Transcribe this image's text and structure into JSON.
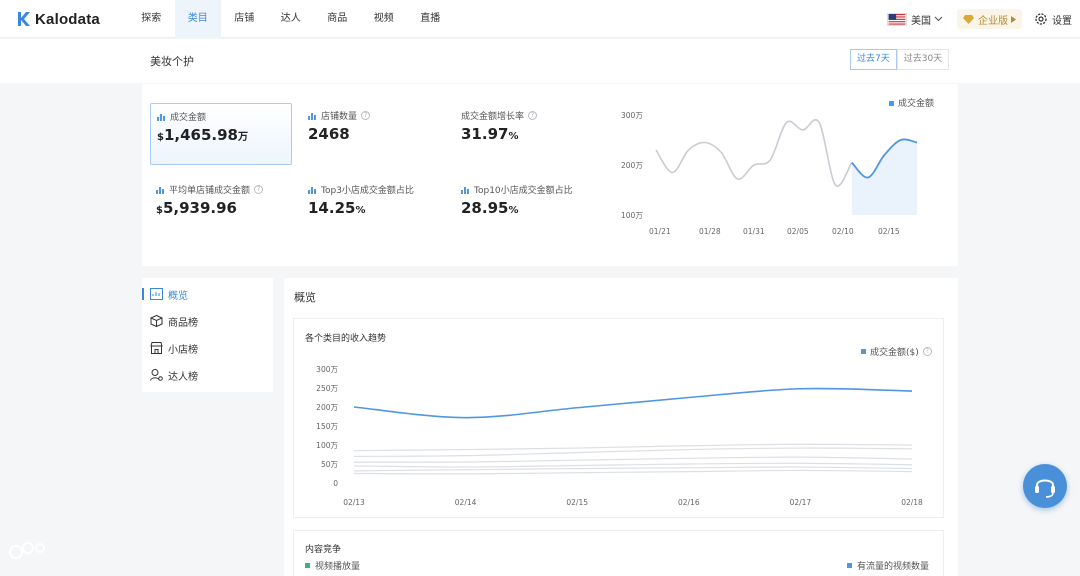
{
  "nav": {
    "brand": "Kalodata",
    "tabs": [
      "探索",
      "类目",
      "店铺",
      "达人",
      "商品",
      "视频",
      "直播"
    ],
    "active_tab": 1,
    "country": "美国",
    "enterprise": "企业版",
    "settings": "设置"
  },
  "header": {
    "title": "美妆个护",
    "range_options": [
      "过去7天",
      "过去30天"
    ],
    "range_active": 0
  },
  "metrics": [
    {
      "label": "成交金额",
      "prefix": "$",
      "value": "1,465.98",
      "suffix": "万",
      "help": false
    },
    {
      "label": "店铺数量",
      "prefix": "",
      "value": "2468",
      "suffix": "",
      "help": true
    },
    {
      "label": "成交金额增长率",
      "prefix": "",
      "value": "31.97",
      "suffix": "%",
      "help": true
    },
    {
      "label": "平均单店铺成交金额",
      "prefix": "$",
      "value": "5,939.96",
      "suffix": "",
      "help": true
    },
    {
      "label": "Top3小店成交金额占比",
      "prefix": "",
      "value": "14.25",
      "suffix": "%",
      "help": false
    },
    {
      "label": "Top10小店成交金额占比",
      "prefix": "",
      "value": "28.95",
      "suffix": "%",
      "help": false
    }
  ],
  "mini_chart": {
    "legend": "成交金额",
    "y_ticks": [
      "300万",
      "200万",
      "100万"
    ],
    "x_ticks": [
      "01/21",
      "01/28",
      "01/31",
      "02/05",
      "02/10",
      "02/15"
    ],
    "color": "#4f96e3"
  },
  "sidebar": {
    "items": [
      "概览",
      "商品榜",
      "小店榜",
      "达人榜"
    ],
    "active": 0
  },
  "overview": {
    "title": "概览",
    "chart_title": "各个类目的收入趋势",
    "legend": "成交金额($)",
    "y_ticks": [
      "300万",
      "250万",
      "200万",
      "150万",
      "100万",
      "50万",
      "0"
    ],
    "x_ticks": [
      "02/13",
      "02/14",
      "02/15",
      "02/16",
      "02/17",
      "02/18"
    ],
    "content_title": "内容竞争",
    "content_legend": [
      "视频播放量",
      "有流量的视频数量"
    ],
    "color": "#4f96e3",
    "content_colors": [
      "#3bb37a",
      "#4f96e3"
    ]
  },
  "chart_data": [
    {
      "type": "line",
      "legend": [
        "成交金额"
      ],
      "x_ticks": [
        "01/21",
        "01/28",
        "01/31",
        "02/05",
        "02/10",
        "02/15"
      ],
      "ylabel": "",
      "ylim": [
        100,
        300
      ],
      "y_unit": "万",
      "series": [
        {
          "name": "成交金额",
          "values": [
            230,
            185,
            230,
            245,
            225,
            172,
            200,
            210,
            285,
            270,
            285,
            160,
            205,
            175,
            220,
            250,
            245
          ]
        }
      ]
    },
    {
      "type": "line",
      "title": "各个类目的收入趋势",
      "x": [
        "02/13",
        "02/14",
        "02/15",
        "02/16",
        "02/17",
        "02/18"
      ],
      "ylim": [
        0,
        300
      ],
      "y_unit": "万",
      "series": [
        {
          "name": "成交金额($)",
          "values": [
            200,
            172,
            198,
            225,
            248,
            242
          ]
        },
        {
          "values": [
            85,
            88,
            92,
            98,
            102,
            100
          ]
        },
        {
          "values": [
            70,
            72,
            80,
            88,
            92,
            90
          ]
        },
        {
          "values": [
            55,
            55,
            60,
            65,
            68,
            63
          ]
        },
        {
          "values": [
            45,
            42,
            46,
            50,
            52,
            48
          ]
        },
        {
          "values": [
            32,
            35,
            38,
            40,
            42,
            38
          ]
        },
        {
          "values": [
            25,
            24,
            27,
            30,
            33,
            30
          ]
        }
      ]
    }
  ]
}
